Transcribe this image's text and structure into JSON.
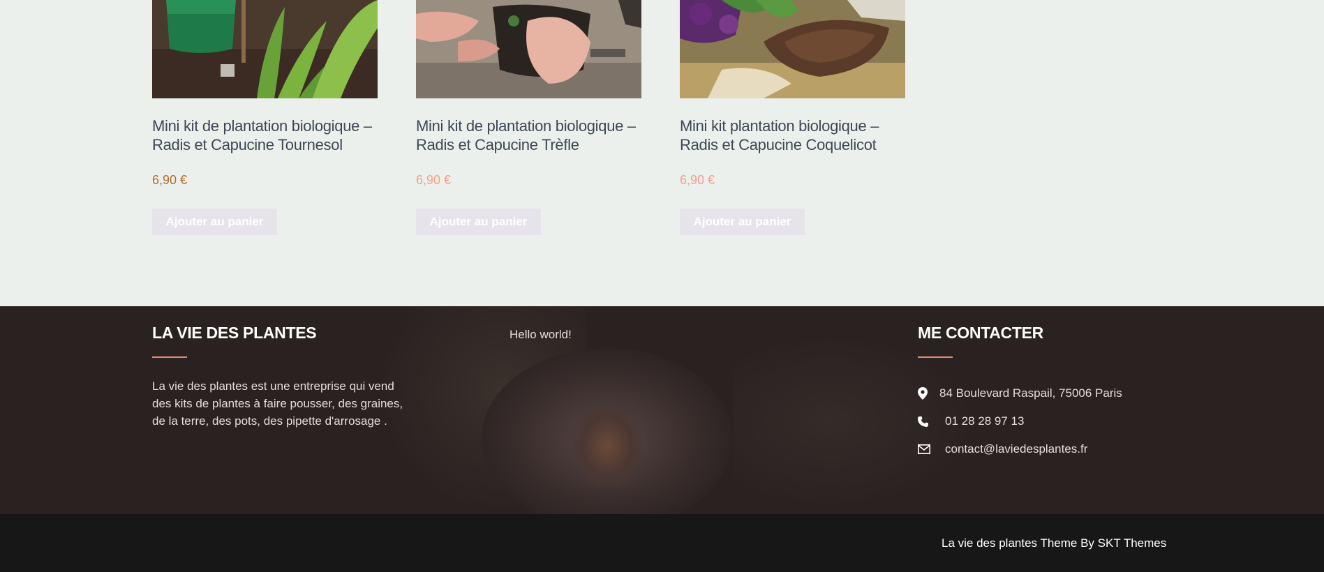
{
  "products": [
    {
      "title": "Mini kit de plantation biologique – Radis et Capucine Tournesol",
      "price": "6,90 €",
      "price_color": "#b46a2a",
      "cart_label": "Ajouter au panier"
    },
    {
      "title": "Mini kit de plantation biologique – Radis et Capucine Trèfle",
      "price": "6,90 €",
      "price_color": "#f3a08a",
      "cart_label": "Ajouter au panier"
    },
    {
      "title": "Mini kit plantation biologique – Radis et Capucine Coquelicot",
      "price": "6,90 €",
      "price_color": "#f3a08a",
      "cart_label": "Ajouter au panier"
    }
  ],
  "footer": {
    "about": {
      "heading": "LA VIE DES PLANTES",
      "text": "La vie des plantes est une entreprise qui vend des kits de plantes à faire pousser, des graines, de la terre, des pots, des pipette d'arrosage ."
    },
    "recent": {
      "link": "Hello world!"
    },
    "contact": {
      "heading": "ME CONTACTER",
      "address": "84 Boulevard Raspail, 75006 Paris",
      "phone": "01 28 28 97 13",
      "email": "contact@laviedesplantes.fr",
      "icons": [
        "map-pin-icon",
        "phone-icon",
        "envelope-icon"
      ]
    },
    "accent_color": "#e98872"
  },
  "bottom_bar": {
    "credit": "La vie des plantes Theme By SKT Themes"
  }
}
